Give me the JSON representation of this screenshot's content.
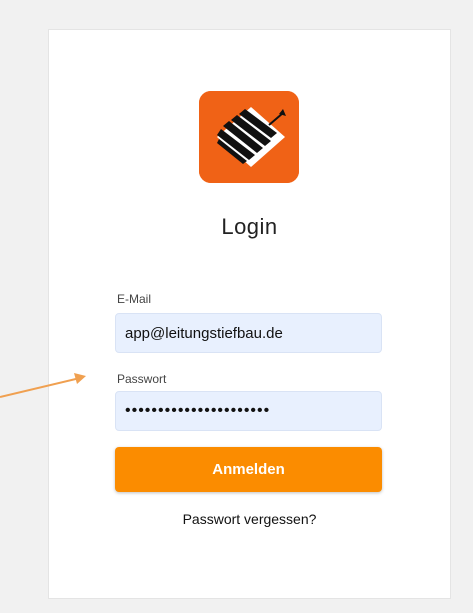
{
  "login": {
    "title": "Login",
    "email_label": "E-Mail",
    "email_value": "app@leitungstiefbau.de",
    "password_label": "Passwort",
    "password_value": "••••••••••••••••••••••",
    "submit_label": "Anmelden",
    "forgot_label": "Passwort vergessen?"
  },
  "colors": {
    "accent": "#fb8c00",
    "logo_background": "#f06216",
    "input_background": "#e8f0fe",
    "annotation_arrow": "#f0a050"
  },
  "icons": {
    "logo": "company-logo-icon",
    "annotation": "pointer-arrow-icon"
  }
}
